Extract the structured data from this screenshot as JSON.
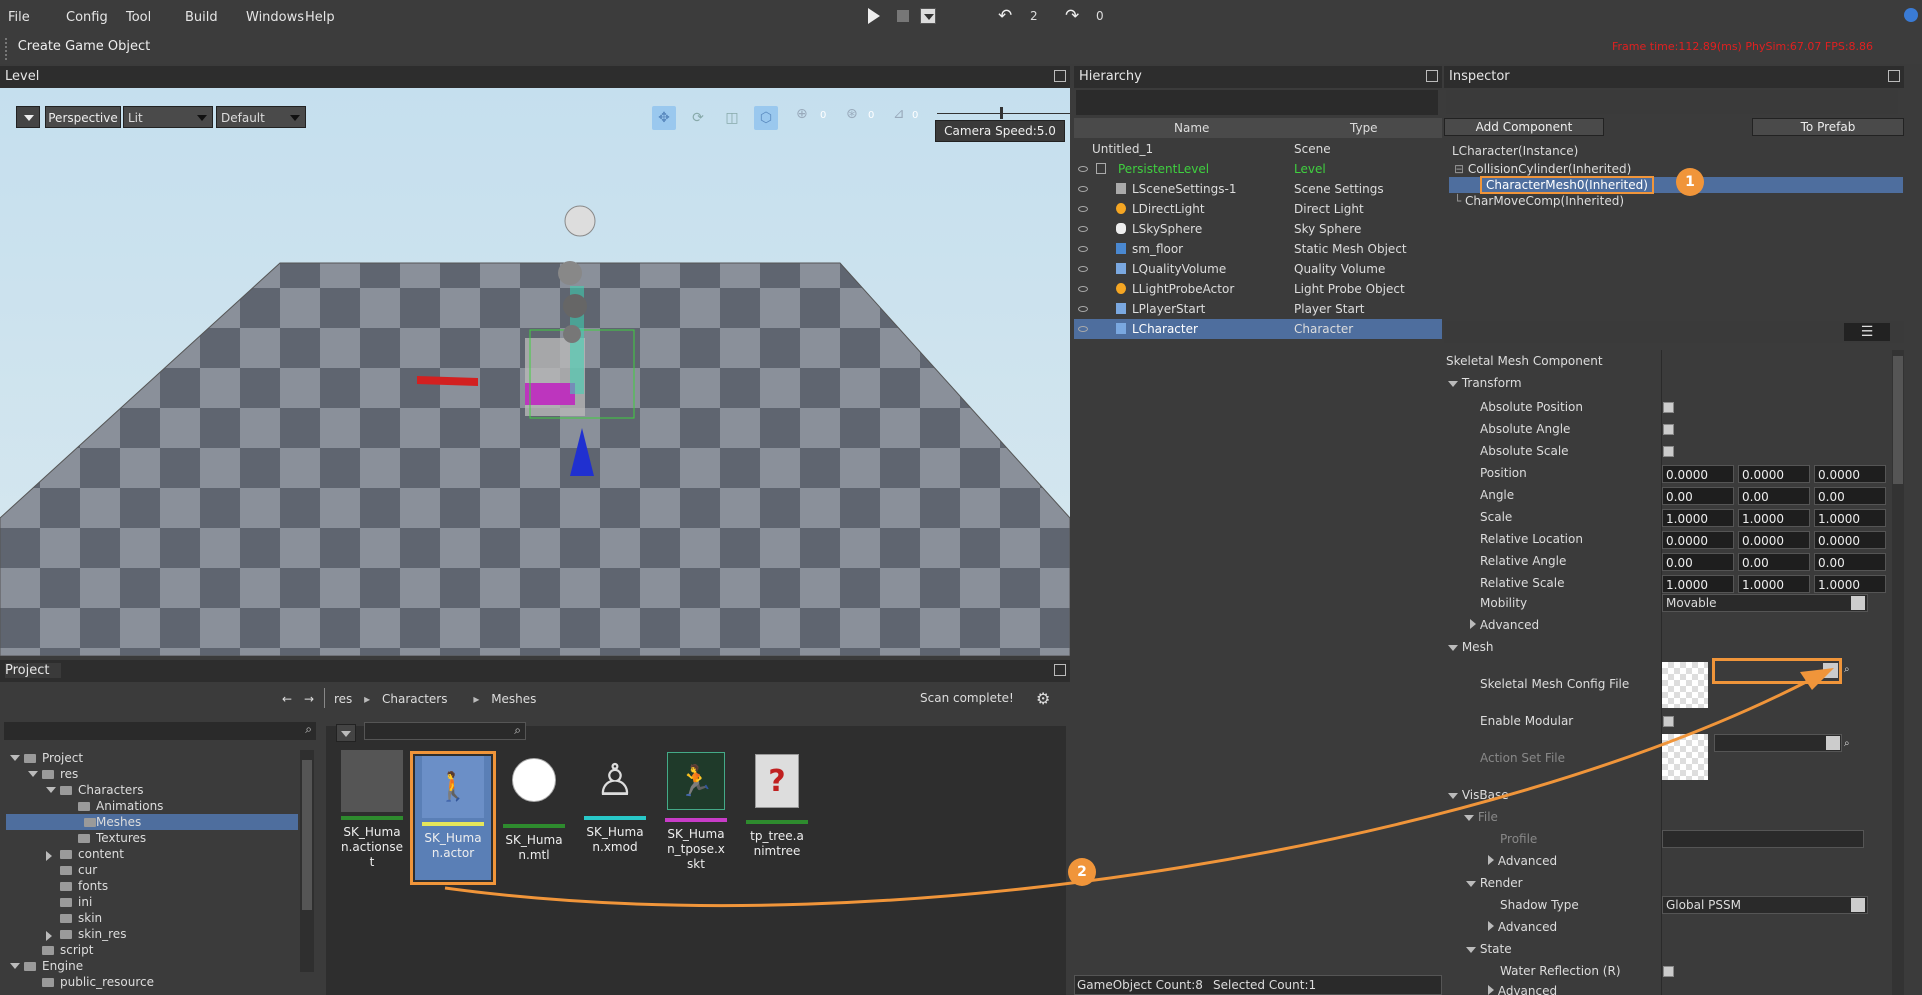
{
  "menubar": {
    "items": [
      "File",
      "Config",
      "Tool",
      "Build",
      "Windows",
      "Help"
    ],
    "undo_count": "2",
    "redo_count": "0"
  },
  "toolbar": {
    "create_label": "Create Game Object",
    "stats": "Frame time:112.89(ms)  PhySim:67.07  FPS:8.86"
  },
  "level": {
    "title": "Level",
    "perspective": "Perspective",
    "lit": "Lit",
    "default": "Default",
    "camera_speed": "Camera Speed:5.0",
    "gizmo_values": [
      "0",
      "0",
      "0"
    ]
  },
  "hierarchy": {
    "title": "Hierarchy",
    "col_name": "Name",
    "col_type": "Type",
    "rows": [
      {
        "name": "Untitled_1",
        "type": "Scene"
      },
      {
        "name": "PersistentLevel",
        "type": "Level"
      },
      {
        "name": "LSceneSettings-1",
        "type": "Scene Settings"
      },
      {
        "name": "LDirectLight",
        "type": "Direct Light"
      },
      {
        "name": "LSkySphere",
        "type": "Sky Sphere"
      },
      {
        "name": "sm_floor",
        "type": "Static Mesh Object"
      },
      {
        "name": "LQualityVolume",
        "type": "Quality Volume"
      },
      {
        "name": "LLightProbeActor",
        "type": "Light Probe Object"
      },
      {
        "name": "LPlayerStart",
        "type": "Player Start"
      },
      {
        "name": "LCharacter",
        "type": "Character"
      }
    ],
    "footer_count": "GameObject Count:8",
    "footer_selected": "Selected Count:1"
  },
  "inspector": {
    "title": "Inspector",
    "add_component": "Add Component",
    "to_prefab": "To Prefab",
    "tree": [
      "LCharacter(Instance)",
      "CollisionCylinder(Inherited)",
      "CharacterMesh0(Inherited)",
      "CharMoveComp(Inherited)"
    ],
    "component": "Skeletal Mesh Component",
    "transform": "Transform",
    "props": [
      {
        "label": "Absolute Position"
      },
      {
        "label": "Absolute Angle"
      },
      {
        "label": "Absolute Scale"
      },
      {
        "label": "Position",
        "v": [
          "0.0000",
          "0.0000",
          "0.0000"
        ]
      },
      {
        "label": "Angle",
        "v": [
          "0.00",
          "0.00",
          "0.00"
        ]
      },
      {
        "label": "Scale",
        "v": [
          "1.0000",
          "1.0000",
          "1.0000"
        ]
      },
      {
        "label": "Relative Location",
        "v": [
          "0.0000",
          "0.0000",
          "0.0000"
        ]
      },
      {
        "label": "Relative Angle",
        "v": [
          "0.00",
          "0.00",
          "0.00"
        ]
      },
      {
        "label": "Relative Scale",
        "v": [
          "1.0000",
          "1.0000",
          "1.0000"
        ]
      }
    ],
    "mobility_label": "Mobility",
    "mobility_value": "Movable",
    "advanced": "Advanced",
    "mesh": "Mesh",
    "skel_file": "Skeletal Mesh Config File",
    "enable_modular": "Enable Modular",
    "action_set": "Action Set File",
    "visbase": "VisBase",
    "file": "File",
    "profile": "Profile",
    "render": "Render",
    "shadow_type": "Shadow Type",
    "shadow_value": "Global PSSM",
    "state": "State",
    "water_reflection": "Water Reflection (R)"
  },
  "project": {
    "title": "Project",
    "breadcrumb": [
      "res",
      "Characters",
      "Meshes"
    ],
    "scan": "Scan complete!",
    "tree": [
      "Project",
      "res",
      "Characters",
      "Animations",
      "Meshes",
      "Textures",
      "content",
      "cur",
      "fonts",
      "ini",
      "skin",
      "skin_res",
      "script",
      "Engine",
      "public_resource"
    ],
    "assets": [
      {
        "name": "SK_Huma n.actionse t",
        "bar": "#2e8b2e"
      },
      {
        "name": "SK_Huma n.actor",
        "bar": "#e6e65a"
      },
      {
        "name": "SK_Huma n.mtl",
        "bar": "#2e8b2e"
      },
      {
        "name": "SK_Huma n.xmod",
        "bar": "#28c8c8"
      },
      {
        "name": "SK_Huma n_tpose.x skt",
        "bar": "#c83cc8"
      },
      {
        "name": "tp_tree.a nimtree",
        "bar": "#2e8b2e"
      }
    ]
  },
  "callouts": [
    "1",
    "2"
  ],
  "colors": {
    "accent": "#f0953a",
    "selection": "#4e6e9e",
    "green": "#3fd03f"
  }
}
